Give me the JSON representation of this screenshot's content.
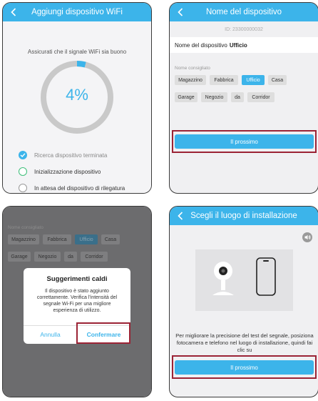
{
  "screen1": {
    "title": "Aggiungi dispositivo WiFi",
    "message": "Assicurati che il signale WiFi sia buono",
    "progress_label": "4%",
    "progress_value": 0.04,
    "steps": [
      "Ricerca dispositivo terminata",
      "Inizializzazione dispositivo",
      "In attesa del dispositivo di rilegatura"
    ]
  },
  "screen2": {
    "title": "Nome del dispositivo",
    "device_id": "ID: 23300000032",
    "name_label": "Nome del dispositivo",
    "name_value": "Ufficio",
    "suggested_label": "Nome consigliato",
    "chips": [
      "Magazzino",
      "Fabbrica",
      "Ufficio",
      "Casa",
      "Garage",
      "Negozio",
      "da",
      "Corridor"
    ],
    "selected_chip": "Ufficio",
    "next_label": "Il prossimo"
  },
  "screen3": {
    "suggested_label": "Nome consigliato",
    "chips": [
      "Magazzino",
      "Fabbrica",
      "Ufficio",
      "Casa",
      "Garage",
      "Negozio",
      "da",
      "Corridor"
    ],
    "dialog": {
      "title": "Suggerimenti caldi",
      "message": "Il dispositivo è stato aggiunto correttamente. Verifica l'intensità del segnale Wi-Fi per una migliore esperienza di utilizzo.",
      "cancel_label": "Annulla",
      "confirm_label": "Confermare"
    }
  },
  "screen4": {
    "title": "Scegli il luogo di installazione",
    "info": "Per migliorare la precisione del test del segnale, posiziona fotocamera e telefono nel luogo di installazione, quindi fai clic su",
    "next_label": "Il prossimo"
  },
  "colors": {
    "accent": "#3cb4ea",
    "highlight": "#9b2335",
    "success": "#3fbf7a"
  },
  "icons": [
    "back-chevron-icon",
    "check-icon",
    "circle-icon",
    "speaker-icon",
    "camera-icon",
    "phone-icon"
  ]
}
